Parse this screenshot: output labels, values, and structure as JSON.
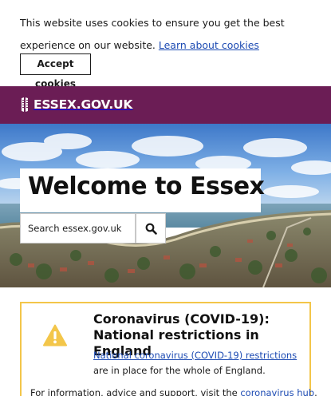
{
  "cookie_banner": {
    "message": "This website uses cookies to ensure you get the best experience on our website.",
    "link_text": "Learn about cookies",
    "accept_label": "Accept cookies"
  },
  "header": {
    "logo_text": "ESSEX.GOV.UK",
    "logo_icon": "essex-seaxes-icon",
    "background_color": "#6b1d55"
  },
  "hero": {
    "title": "Welcome to Essex",
    "search": {
      "placeholder": "Search essex.gov.uk",
      "button_icon": "search-icon"
    }
  },
  "notice": {
    "icon": "warning-icon",
    "border_color": "#f3c64a",
    "title": "Coronavirus (COVID-19): National restrictions in England",
    "body_link": "National coronavirus (COVID-19) restrictions",
    "body_text": " are in place for the whole of England.",
    "footer_text": "For information, advice and support, visit the ",
    "footer_link": "coronavirus hub",
    "footer_end": "."
  },
  "colors": {
    "link": "#1d4bb3",
    "text": "#1a1a1a"
  }
}
